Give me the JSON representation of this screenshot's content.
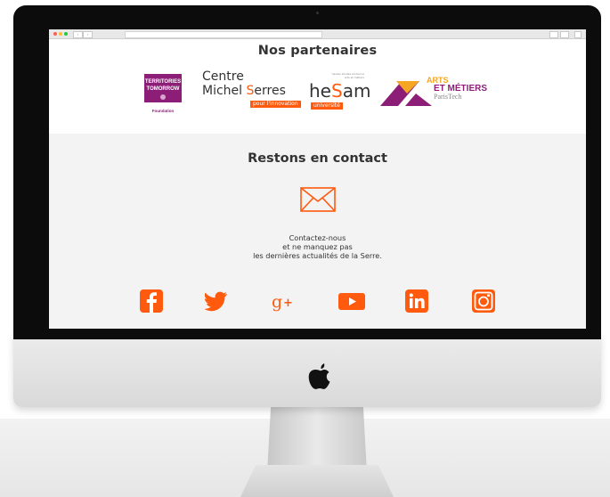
{
  "partners": {
    "title": "Nos partenaires",
    "logos": {
      "territories": {
        "line1": "TERRITORIES",
        "line2": "TOMORROW",
        "foot": "Foundation"
      },
      "michel_serres": {
        "line1": "Centre",
        "line2_part1": "Michel ",
        "line2_s": "S",
        "line2_part2": "erres",
        "tag": "pour l'innovation"
      },
      "hesam": {
        "he": "he",
        "s": "S",
        "am": "am",
        "small": "hautes études sorbonne arts et métiers",
        "tag": "université"
      },
      "arts_metiers": {
        "line1": "ARTS",
        "line2": "ET MÉTIERS",
        "line3": "ParisTech"
      }
    }
  },
  "contact": {
    "title": "Restons en contact",
    "lines": [
      "Contactez-nous",
      "et ne manquez pas",
      "les dernières actualités de la Serre."
    ]
  },
  "socials": [
    "facebook-icon",
    "twitter-icon",
    "google-plus-icon",
    "youtube-icon",
    "linkedin-icon",
    "instagram-icon"
  ],
  "colors": {
    "accent": "#ff5a0e",
    "purple": "#8d1e78",
    "contact_bg": "#f3f3f3"
  }
}
